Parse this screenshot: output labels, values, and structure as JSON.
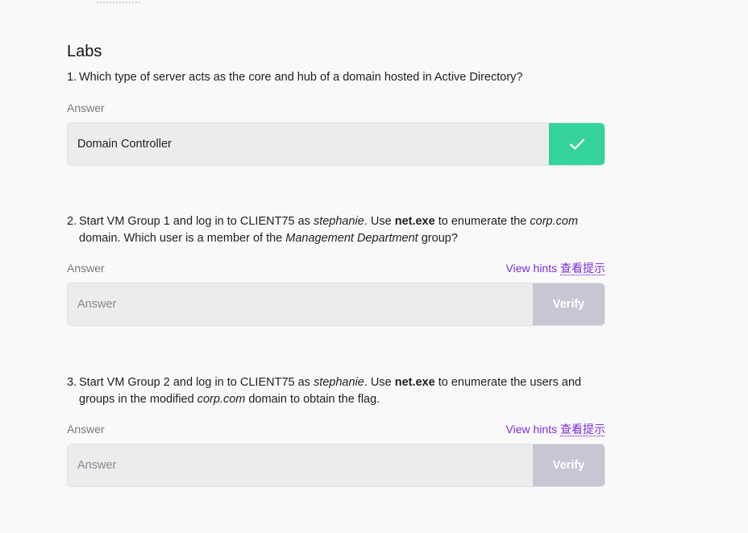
{
  "labs": {
    "title": "Labs",
    "questions": [
      {
        "number": "1.",
        "text_parts": [
          {
            "t": "Which type of server acts as the core and hub of a domain hosted in Active Directory?"
          }
        ],
        "answer_label": "Answer",
        "answer_value": "Domain Controller",
        "status": "correct"
      },
      {
        "number": "2.",
        "text_parts": [
          {
            "t": "Start VM Group 1 and log in to CLIENT75 as "
          },
          {
            "t": "stephanie",
            "i": true
          },
          {
            "t": ". Use "
          },
          {
            "t": "net.exe",
            "b": true
          },
          {
            "t": " to enumerate the "
          },
          {
            "t": "corp.com",
            "i": true
          },
          {
            "t": " domain. Which user is a member of the "
          },
          {
            "t": "Management Department",
            "i": true
          },
          {
            "t": " group?"
          }
        ],
        "answer_label": "Answer",
        "hints_label": "View hints",
        "hints_label_cn": "查看提示",
        "placeholder": "Answer",
        "verify_label": "Verify"
      },
      {
        "number": "3.",
        "text_parts": [
          {
            "t": "Start VM Group 2 and log in to CLIENT75 as "
          },
          {
            "t": "stephanie",
            "i": true
          },
          {
            "t": ". Use "
          },
          {
            "t": "net.exe",
            "b": true
          },
          {
            "t": " to enumerate the users and groups in the modified "
          },
          {
            "t": "corp.com",
            "i": true
          },
          {
            "t": " domain to obtain the flag."
          }
        ],
        "answer_label": "Answer",
        "hints_label": "View hints",
        "hints_label_cn": "查看提示",
        "placeholder": "Answer",
        "verify_label": "Verify"
      }
    ]
  },
  "colors": {
    "accent_purple": "#7b2fd6",
    "success_green": "#34d39a",
    "verify_disabled": "#c9c5d2"
  }
}
